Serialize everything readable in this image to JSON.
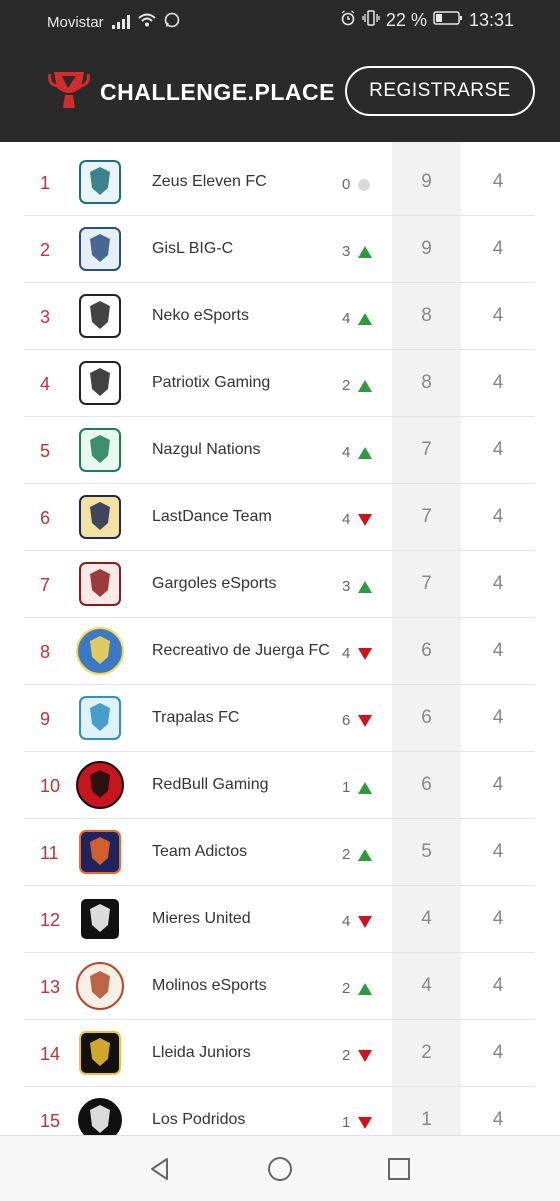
{
  "status_bar": {
    "carrier": "Movistar",
    "battery_percent": "22 %",
    "time": "13:31"
  },
  "header": {
    "logo_text": "CHALLENGE.PLACE",
    "register_label": "REGISTRARSE"
  },
  "standings": [
    {
      "rank": "1",
      "team": "Zeus Eleven FC",
      "change": "0",
      "trend": "none",
      "points": "9",
      "played": "4"
    },
    {
      "rank": "2",
      "team": "GisL BIG-C",
      "change": "3",
      "trend": "up",
      "points": "9",
      "played": "4"
    },
    {
      "rank": "3",
      "team": "Neko eSports",
      "change": "4",
      "trend": "up",
      "points": "8",
      "played": "4"
    },
    {
      "rank": "4",
      "team": "Patriotix Gaming",
      "change": "2",
      "trend": "up",
      "points": "8",
      "played": "4"
    },
    {
      "rank": "5",
      "team": "Nazgul Nations",
      "change": "4",
      "trend": "up",
      "points": "7",
      "played": "4"
    },
    {
      "rank": "6",
      "team": "LastDance Team",
      "change": "4",
      "trend": "down",
      "points": "7",
      "played": "4"
    },
    {
      "rank": "7",
      "team": "Gargoles eSports",
      "change": "3",
      "trend": "up",
      "points": "7",
      "played": "4"
    },
    {
      "rank": "8",
      "team": "Recreativo de Juerga FC",
      "change": "4",
      "trend": "down",
      "points": "6",
      "played": "4"
    },
    {
      "rank": "9",
      "team": "Trapalas FC",
      "change": "6",
      "trend": "down",
      "points": "6",
      "played": "4"
    },
    {
      "rank": "10",
      "team": "RedBull Gaming",
      "change": "1",
      "trend": "up",
      "points": "6",
      "played": "4"
    },
    {
      "rank": "11",
      "team": "Team Adictos",
      "change": "2",
      "trend": "up",
      "points": "5",
      "played": "4"
    },
    {
      "rank": "12",
      "team": "Mieres United",
      "change": "4",
      "trend": "down",
      "points": "4",
      "played": "4"
    },
    {
      "rank": "13",
      "team": "Molinos eSports",
      "change": "2",
      "trend": "up",
      "points": "4",
      "played": "4"
    },
    {
      "rank": "14",
      "team": "Lleida Juniors",
      "change": "2",
      "trend": "down",
      "points": "2",
      "played": "4"
    },
    {
      "rank": "15",
      "team": "Los Podridos",
      "change": "1",
      "trend": "down",
      "points": "1",
      "played": "4"
    }
  ],
  "logo_styles": [
    {
      "bg": "#e8f4f6",
      "fg": "#1b6e7a",
      "shape": "rect"
    },
    {
      "bg": "#e6eef8",
      "fg": "#2b4f82",
      "shape": "rect"
    },
    {
      "bg": "#ffffff",
      "fg": "#222222",
      "shape": "rect"
    },
    {
      "bg": "#ffffff",
      "fg": "#222222",
      "shape": "rect"
    },
    {
      "bg": "#e9f7f1",
      "fg": "#1e7a5a",
      "shape": "rect"
    },
    {
      "bg": "#f3e2a0",
      "fg": "#1d2a55",
      "shape": "rect"
    },
    {
      "bg": "#fbe9e9",
      "fg": "#8a1c1c",
      "shape": "rect"
    },
    {
      "bg": "#3a78c8",
      "fg": "#ffd84a",
      "shape": "circle"
    },
    {
      "bg": "#dff2fb",
      "fg": "#2d8fc2",
      "shape": "rect"
    },
    {
      "bg": "#c8141c",
      "fg": "#111111",
      "shape": "circle"
    },
    {
      "bg": "#1d2560",
      "fg": "#f26a21",
      "shape": "rect"
    },
    {
      "bg": "#111111",
      "fg": "#ffffff",
      "shape": "rect"
    },
    {
      "bg": "#f5f0e6",
      "fg": "#b34a2a",
      "shape": "circle"
    },
    {
      "bg": "#111111",
      "fg": "#f2c230",
      "shape": "rect"
    },
    {
      "bg": "#111111",
      "fg": "#ffffff",
      "shape": "circle"
    }
  ],
  "colors": {
    "header_bg": "#2a2a2a",
    "rank_red": "#c53030",
    "trend_up": "#2e9a3e",
    "trend_down": "#d0121b",
    "neutral_dot": "#d9d9d9",
    "points_column_bg": "#f2f2f2"
  }
}
